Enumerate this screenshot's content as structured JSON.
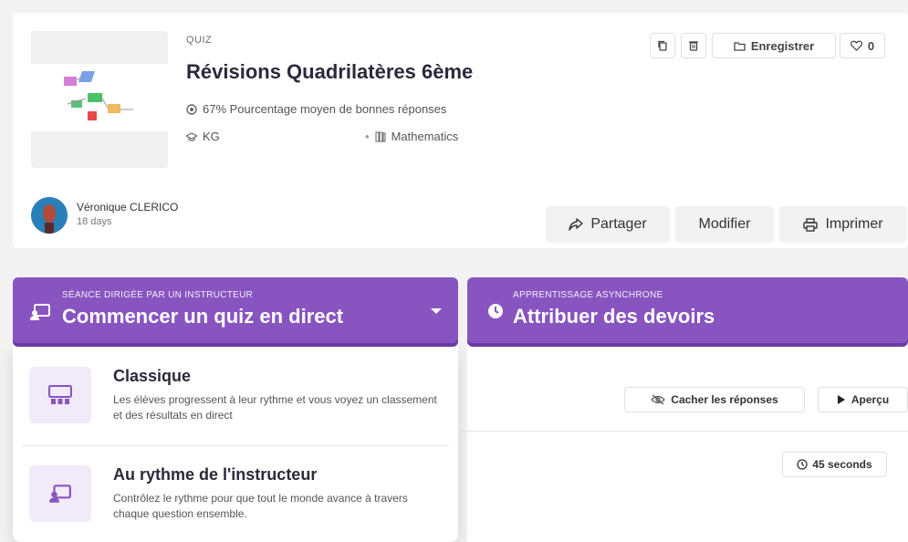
{
  "quiz": {
    "type_label": "QUIZ",
    "title": "Révisions Quadrilatères 6ème",
    "accuracy": "67% Pourcentage moyen de bonnes réponses",
    "grade": "KG",
    "subject": "Mathematics"
  },
  "top_actions": {
    "save_label": "Enregistrer",
    "like_count": "0"
  },
  "author": {
    "name": "Véronique CLERICO",
    "time_ago": "18 days"
  },
  "actions": {
    "share_label": "Partager",
    "edit_label": "Modifier",
    "print_label": "Imprimer"
  },
  "live": {
    "subtitle": "SÉANCE DIRIGÉE PAR UN INSTRUCTEUR",
    "title": "Commencer un quiz en direct"
  },
  "async": {
    "subtitle": "APPRENTISSAGE ASYNCHRONE",
    "title": "Attribuer des devoirs"
  },
  "dropdown": {
    "options": [
      {
        "title": "Classique",
        "description": "Les élèves progressent à leur rythme et vous voyez un classement et des résultats en direct"
      },
      {
        "title": "Au rythme de l'instructeur",
        "description": "Contrôlez le rythme pour que tout le monde avance à travers chaque question ensemble."
      }
    ]
  },
  "questions_panel": {
    "hide_answers_label": "Cacher les réponses",
    "preview_label": "Aperçu",
    "time_label": "45 seconds"
  },
  "colors": {
    "brand_purple": "#8854c0",
    "icon_purple_bg": "#f1eaf8"
  }
}
